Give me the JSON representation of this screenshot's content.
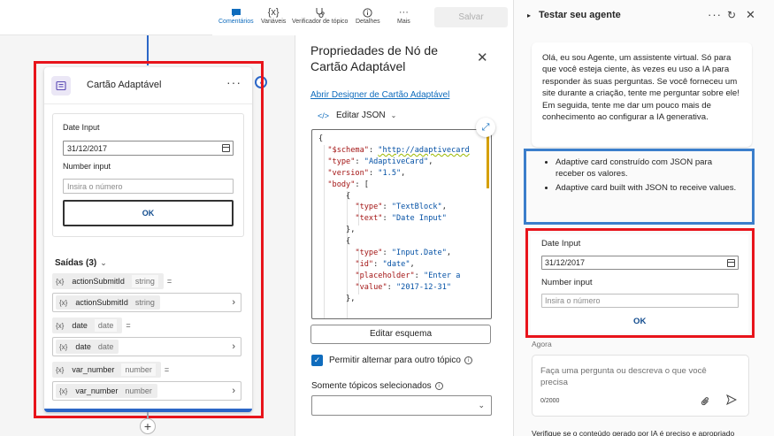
{
  "toolbar": {
    "items": [
      {
        "label": "Comentários",
        "icon": "comment-icon"
      },
      {
        "label": "Variáveis",
        "icon": "variable-icon"
      },
      {
        "label": "Verificador de tópico",
        "icon": "stethoscope-icon"
      },
      {
        "label": "Detalhes",
        "icon": "info-icon"
      },
      {
        "label": "Mais",
        "icon": "more-icon"
      }
    ],
    "save_label": "Salvar",
    "accent": "#0f6cbd"
  },
  "canvas": {
    "node": {
      "title": "Cartão Adaptável",
      "card": {
        "date_label": "Date Input",
        "date_value": "31/12/2017",
        "number_label": "Number input",
        "number_placeholder": "Insira o número",
        "ok_label": "OK"
      },
      "outputs_label": "Saídas (3)",
      "outputs": [
        {
          "name": "actionSubmitId",
          "type": "string",
          "eq": "="
        },
        {
          "name": "date",
          "type": "date",
          "eq": "="
        },
        {
          "name": "var_number",
          "type": "number",
          "eq": "="
        }
      ]
    },
    "plus": "+"
  },
  "properties": {
    "title": "Propriedades de Nó de Cartão Adaptável",
    "designer_link": "Abrir Designer de Cartão Adaptável",
    "edit_json_label": "Editar JSON",
    "json_lines": [
      "{",
      "  \"$schema\": \"http://adaptivecard",
      "  \"type\": \"AdaptiveCard\",",
      "  \"version\": \"1.5\",",
      "  \"body\": [",
      "      {",
      "        \"type\": \"TextBlock\",",
      "        \"text\": \"Date Input\"",
      "      },",
      "      {",
      "        \"type\": \"Input.Date\",",
      "        \"id\": \"date\",",
      "        \"placeholder\": \"Enter a",
      "        \"value\": \"2017-12-31\"",
      "      },"
    ],
    "edit_schema_label": "Editar esquema",
    "allow_switch_label": "Permitir alternar para outro tópico",
    "only_topics_label": "Somente tópicos selecionados"
  },
  "test_panel": {
    "title": "Testar seu agente",
    "greeting": "Olá, eu sou Agente, um assistente virtual. Só para que você esteja ciente, às vezes eu uso a IA para responder às suas perguntas. Se você forneceu um site durante a criação, tente me perguntar sobre ele! Em seguida, tente me dar um pouco mais de conhecimento ao configurar a IA generativa.",
    "bullets": [
      "Adaptive card construído com JSON para receber os valores.",
      "Adaptive card built with JSON to receive values."
    ],
    "card": {
      "date_label": "Date Input",
      "date_value": "31/12/2017",
      "number_label": "Number input",
      "number_placeholder": "Insira o número",
      "ok_label": "OK"
    },
    "timestamp": "Agora",
    "input_placeholder": "Faça uma pergunta ou descreva o que você precisa",
    "char_count": "0/2000",
    "footer": "Verifique se o conteúdo gerado por IA é preciso e apropriado"
  },
  "colors": {
    "highlight_red": "#e8141b",
    "highlight_blue": "#3b7ecb",
    "link": "#0f6cbd"
  }
}
